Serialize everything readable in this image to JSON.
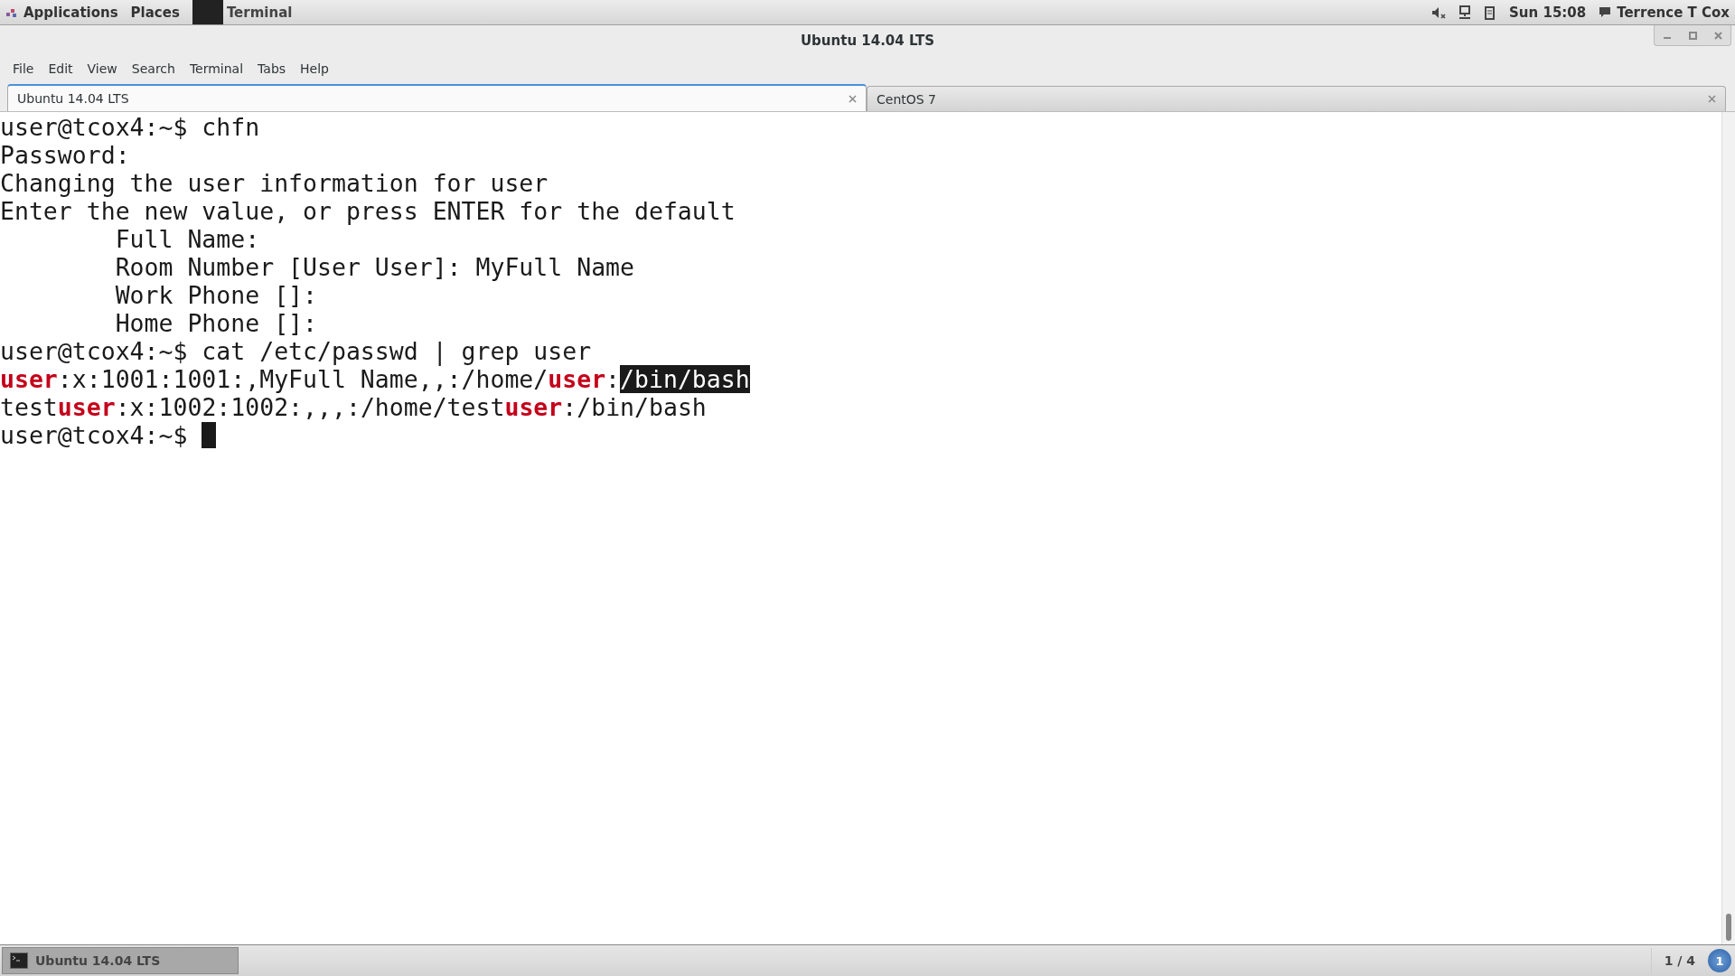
{
  "top_panel": {
    "applications": "Applications",
    "places": "Places",
    "task": "Terminal",
    "clock": "Sun 15:08",
    "user": "Terrence T Cox"
  },
  "window": {
    "title": "Ubuntu 14.04 LTS"
  },
  "menu": [
    "File",
    "Edit",
    "View",
    "Search",
    "Terminal",
    "Tabs",
    "Help"
  ],
  "tabs": [
    {
      "label": "Ubuntu 14.04 LTS",
      "selected": true
    },
    {
      "label": "CentOS 7",
      "selected": false
    }
  ],
  "terminal": {
    "lines": [
      {
        "segments": [
          {
            "kind": "plain",
            "text": "user@tcox4:~$ chfn"
          }
        ]
      },
      {
        "segments": [
          {
            "kind": "plain",
            "text": "Password:"
          }
        ]
      },
      {
        "segments": [
          {
            "kind": "plain",
            "text": "Changing the user information for user"
          }
        ]
      },
      {
        "segments": [
          {
            "kind": "plain",
            "text": "Enter the new value, or press ENTER for the default"
          }
        ]
      },
      {
        "segments": [
          {
            "kind": "plain",
            "text": "        Full Name:"
          }
        ]
      },
      {
        "segments": [
          {
            "kind": "plain",
            "text": "        Room Number [User User]: MyFull Name"
          }
        ]
      },
      {
        "segments": [
          {
            "kind": "plain",
            "text": "        Work Phone []:"
          }
        ]
      },
      {
        "segments": [
          {
            "kind": "plain",
            "text": "        Home Phone []:"
          }
        ]
      },
      {
        "segments": [
          {
            "kind": "plain",
            "text": "user@tcox4:~$ cat /etc/passwd | grep user"
          }
        ]
      },
      {
        "segments": [
          {
            "kind": "match",
            "text": "user"
          },
          {
            "kind": "plain",
            "text": ":x:1001:1001:,MyFull Name,,:/home/"
          },
          {
            "kind": "match",
            "text": "user"
          },
          {
            "kind": "plain",
            "text": ":"
          },
          {
            "kind": "selected",
            "text": "/bin/bash"
          }
        ]
      },
      {
        "segments": [
          {
            "kind": "plain",
            "text": "test"
          },
          {
            "kind": "match",
            "text": "user"
          },
          {
            "kind": "plain",
            "text": ":x:1002:1002:,,,:/home/test"
          },
          {
            "kind": "match",
            "text": "user"
          },
          {
            "kind": "plain",
            "text": ":/bin/bash"
          }
        ]
      },
      {
        "segments": [
          {
            "kind": "plain",
            "text": "user@tcox4:~$ "
          }
        ],
        "cursor": true
      }
    ]
  },
  "taskbar": {
    "window_button": {
      "label": "Ubuntu 14.04 LTS",
      "selected": true
    },
    "workspace": "1 / 4",
    "notifications": "1"
  }
}
